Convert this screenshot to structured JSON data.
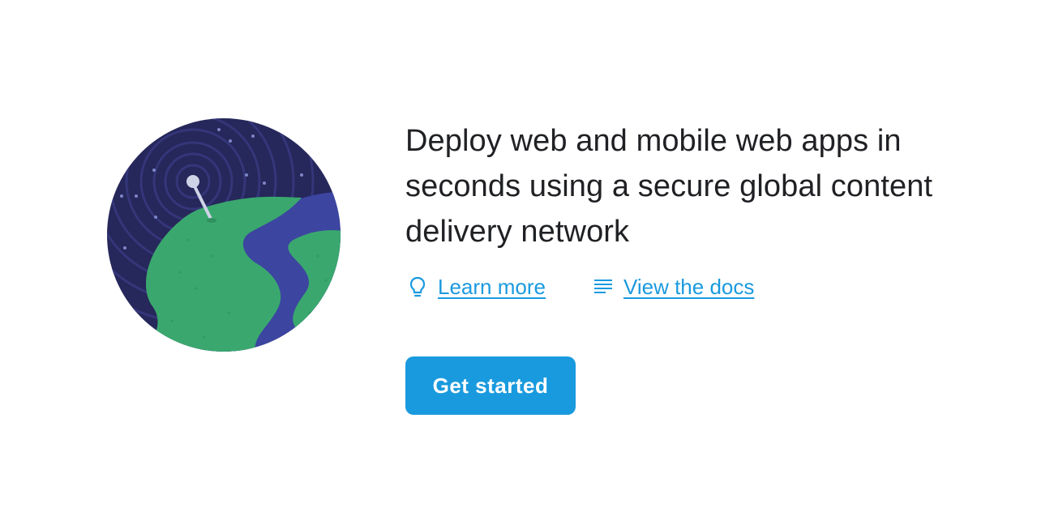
{
  "hero": {
    "headline": "Deploy web and mobile web apps in seconds using a secure global content delivery network",
    "links": [
      {
        "label": "Learn more",
        "icon": "lightbulb-icon"
      },
      {
        "label": "View the docs",
        "icon": "docs-lines-icon"
      }
    ],
    "cta_label": "Get started"
  },
  "colors": {
    "accent": "#1a9ade",
    "text": "#202124",
    "space": "#27275a",
    "land": "#3aa86e",
    "ocean": "#3c45a0"
  }
}
